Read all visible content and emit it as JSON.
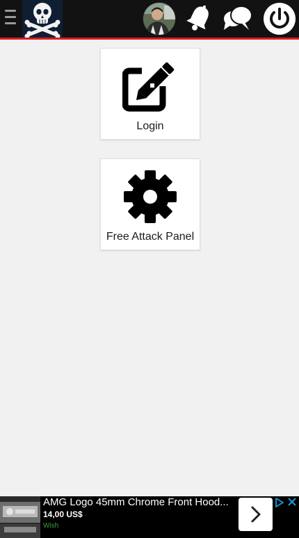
{
  "header": {
    "menu_icon": "hamburger-menu-icon",
    "logo_icon": "skull-crossbones-logo",
    "avatar_icon": "user-avatar",
    "bell_icon": "notification-bell-icon",
    "chat_icon": "chat-bubbles-icon",
    "power_icon": "power-icon",
    "accent_color": "#d81e1e",
    "background_color": "#121212"
  },
  "tiles": [
    {
      "label": "Login",
      "icon": "edit-pencil-icon"
    },
    {
      "label": "Free Attack Panel",
      "icon": "gear-icon"
    }
  ],
  "ad": {
    "title": "AMG Logo 45mm Chrome Front Hood...",
    "price": "14,00 US$",
    "source": "Wish",
    "cta_icon": "chevron-right-icon",
    "choices_icon": "ad-choices-icon",
    "close_icon": "close-icon"
  }
}
